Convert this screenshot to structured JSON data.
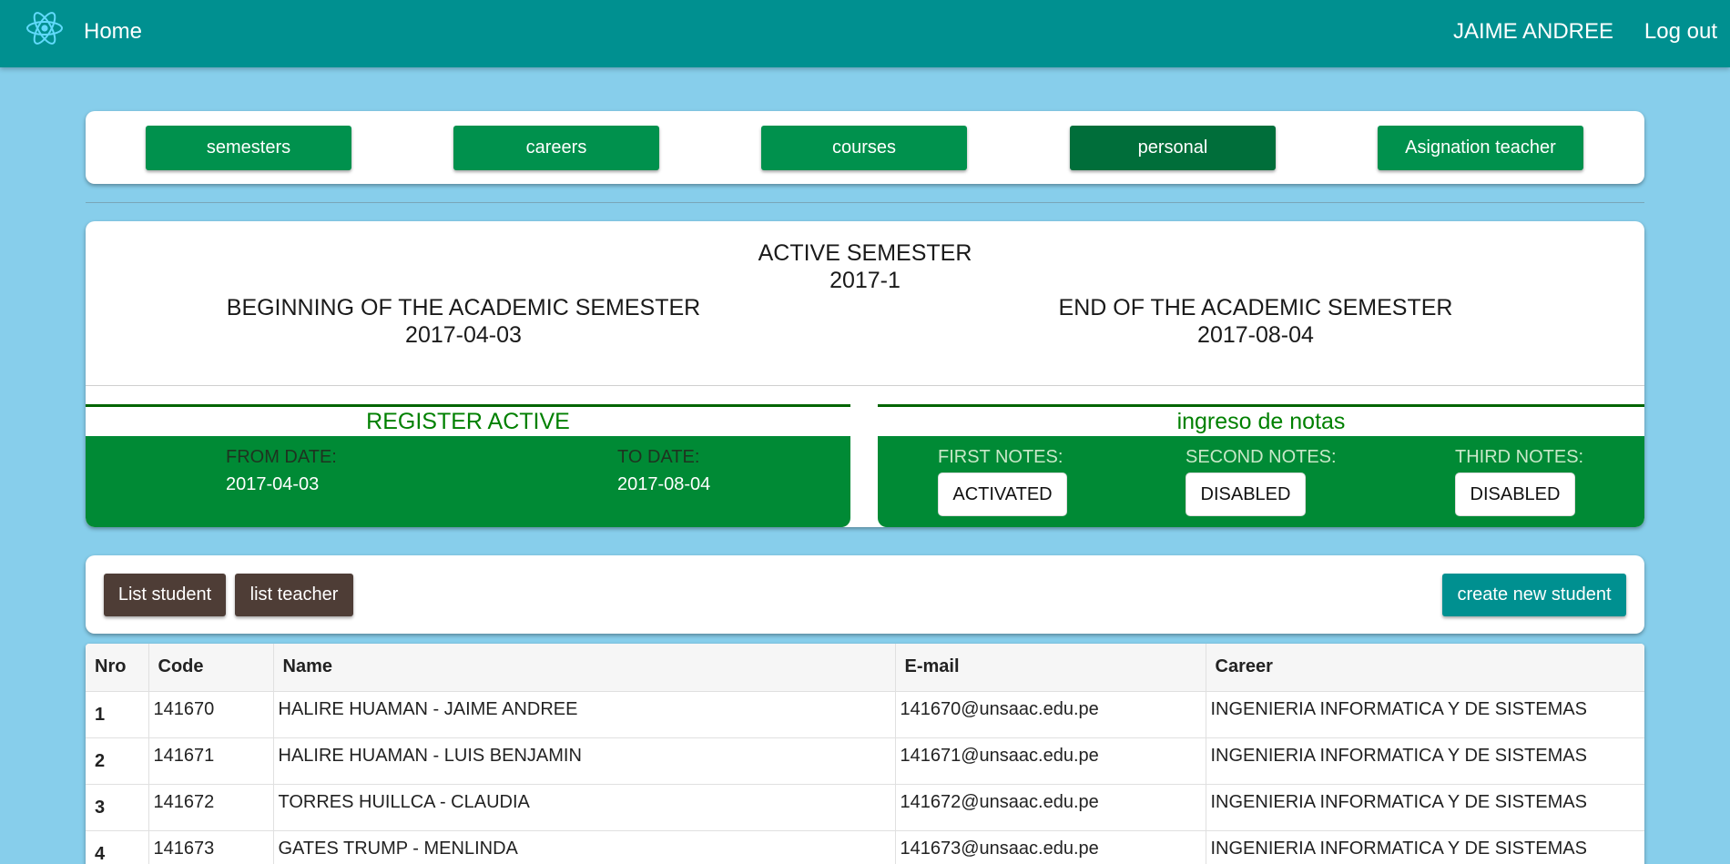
{
  "header": {
    "logo_icon": "react-atom-icon",
    "home_label": "Home",
    "user_name": "JAIME ANDREE",
    "logout_label": "Log out"
  },
  "nav": {
    "buttons": [
      {
        "label": "semesters",
        "active": false
      },
      {
        "label": "careers",
        "active": false
      },
      {
        "label": "courses",
        "active": false
      },
      {
        "label": "personal",
        "active": true
      },
      {
        "label": "Asignation teacher",
        "active": false
      }
    ]
  },
  "semester": {
    "title": "ACTIVE SEMESTER",
    "code": "2017-1",
    "begin_label": "BEGINNING OF THE ACADEMIC SEMESTER",
    "begin_date": "2017-04-03",
    "end_label": "END OF THE ACADEMIC SEMESTER",
    "end_date": "2017-08-04"
  },
  "register": {
    "title": "REGISTER ACTIVE",
    "from_label": "FROM DATE:",
    "from_value": "2017-04-03",
    "to_label": "TO DATE:",
    "to_value": "2017-08-04"
  },
  "notes": {
    "title": "ingreso de notas",
    "first_label": "FIRST NOTES:",
    "first_state": "ACTIVATED",
    "second_label": "SECOND NOTES:",
    "second_state": "DISABLED",
    "third_label": "THIRD NOTES:",
    "third_state": "DISABLED"
  },
  "actions": {
    "list_student": "List student",
    "list_teacher": "list teacher",
    "create_student": "create new student"
  },
  "table": {
    "columns": [
      "Nro",
      "Code",
      "Name",
      "E-mail",
      "Career"
    ],
    "rows": [
      {
        "nro": "1",
        "code": "141670",
        "name": "HALIRE HUAMAN - JAIME ANDREE",
        "email": "141670@unsaac.edu.pe",
        "career": "INGENIERIA INFORMATICA Y DE SISTEMAS"
      },
      {
        "nro": "2",
        "code": "141671",
        "name": "HALIRE HUAMAN - LUIS BENJAMIN",
        "email": "141671@unsaac.edu.pe",
        "career": "INGENIERIA INFORMATICA Y DE SISTEMAS"
      },
      {
        "nro": "3",
        "code": "141672",
        "name": "TORRES HUILLCA - CLAUDIA",
        "email": "141672@unsaac.edu.pe",
        "career": "INGENIERIA INFORMATICA Y DE SISTEMAS"
      },
      {
        "nro": "4",
        "code": "141673",
        "name": "GATES TRUMP - MENLINDA",
        "email": "141673@unsaac.edu.pe",
        "career": "INGENIERIA INFORMATICA Y DE SISTEMAS"
      }
    ]
  },
  "colors": {
    "topbar": "#009090",
    "background": "#87ceeb",
    "nav_button": "#00914d",
    "nav_button_active": "#006e3a",
    "panel_green": "#008a35",
    "brown_button": "#4e3d36"
  }
}
